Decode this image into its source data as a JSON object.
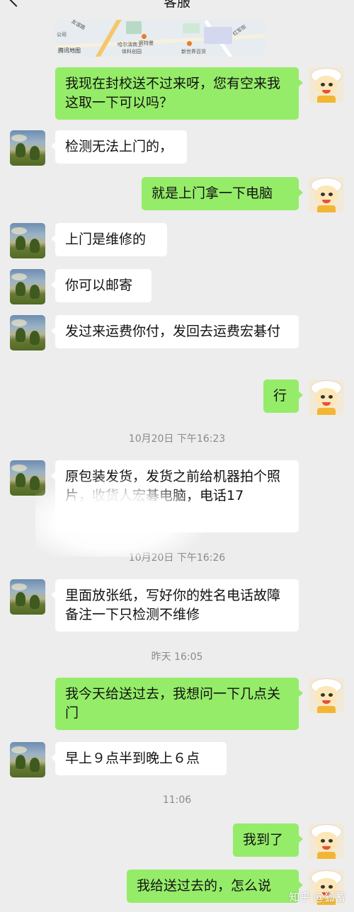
{
  "header": {
    "title": "客服",
    "back_icon": "back-arrow-icon",
    "more_icon": "more-dots-icon",
    "more_label": "•••"
  },
  "map": {
    "labels": [
      "公司",
      "友谊路",
      "哈尔滨商工",
      "体科创园",
      "斑特曼",
      "新世界百货",
      "红军街"
    ],
    "logo": "腾讯地图"
  },
  "messages": [
    {
      "side": "right",
      "text": "我现在封校送不过来呀，您有空来我这取一下可以吗？"
    },
    {
      "side": "left",
      "text": "检测无法上门的，"
    },
    {
      "side": "right",
      "text": "就是上门拿一下电脑"
    },
    {
      "side": "left",
      "text": "上门是维修的"
    },
    {
      "side": "left",
      "text": "你可以邮寄"
    },
    {
      "side": "left",
      "text": "发过来运费你付，发回去运费宏碁付"
    },
    {
      "side": "right",
      "text": "行"
    },
    {
      "side": "left",
      "text": "原包装发货，发货之前给机器拍个照片，收货人宏碁电脑，电话17"
    },
    {
      "side": "left",
      "text": "里面放张纸，写好你的姓名电话故障备注一下只检测不维修"
    },
    {
      "side": "right",
      "text": "我今天给送过去，我想问一下几点关门"
    },
    {
      "side": "left",
      "text": "早上９点半到晚上６点"
    },
    {
      "side": "right",
      "text": "我到了"
    },
    {
      "side": "right",
      "text": "我给送过去的，怎么说"
    }
  ],
  "timestamps": [
    "10月20日 下午16:23",
    "10月20日 下午16:26",
    "昨天 16:05",
    "11:06"
  ],
  "watermark": "知乎 @狐蓄",
  "colors": {
    "background": "#ededed",
    "self_bubble": "#95ec69",
    "other_bubble": "#ffffff",
    "timestamp": "#8a8a8a"
  }
}
